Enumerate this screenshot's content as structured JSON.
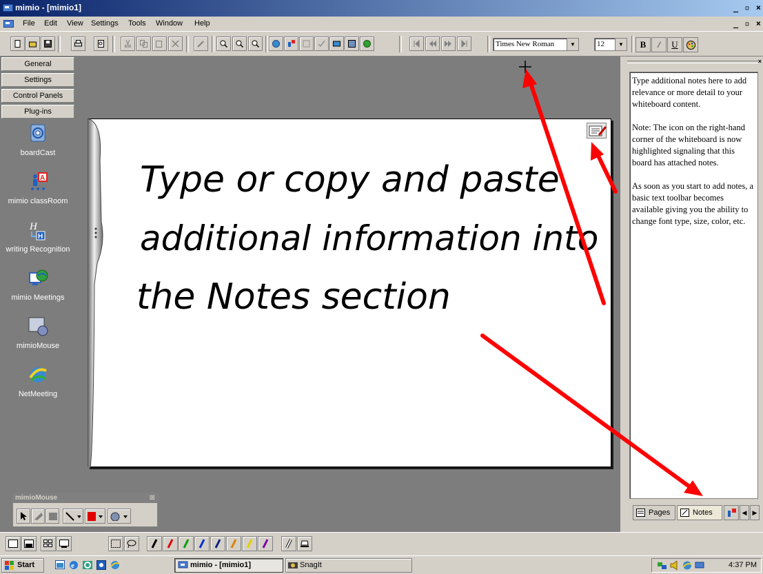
{
  "window": {
    "title": "mimio - [mimio1]",
    "controls": "_ ▫ ×"
  },
  "menu": {
    "items": [
      "File",
      "Edit",
      "View",
      "Settings",
      "Tools",
      "Window",
      "Help"
    ]
  },
  "toolbar": {
    "font_name": "Times New Roman",
    "font_size": "12",
    "bold_label": "B",
    "italic_label": "/",
    "underline_label": "U"
  },
  "sidebar": {
    "headers": [
      "General",
      "Settings",
      "Control Panels",
      "Plug-ins"
    ],
    "plugins": [
      {
        "label": "boardCast",
        "icon": "boardcast-icon"
      },
      {
        "label": "mimio classRoom",
        "icon": "classroom-icon"
      },
      {
        "label": "writing Recognition",
        "icon": "writing-recognition-icon"
      },
      {
        "label": "mimio Meetings",
        "icon": "meetings-icon"
      },
      {
        "label": "mimioMouse",
        "icon": "mimiomouse-icon"
      },
      {
        "label": "NetMeeting",
        "icon": "netmeeting-icon"
      }
    ]
  },
  "board": {
    "handwriting": [
      "Type or copy and paste",
      "additional information into",
      "the Notes section"
    ]
  },
  "notes": {
    "paragraphs": [
      "Type additional notes here to add relevance or more detail to your whiteboard content.",
      "Note: The icon on the right-hand corner of the whiteboard is now highlighted signaling that this board has attached notes.",
      "As soon as you start to add notes, a basic text toolbar becomes available giving you the ability to change font type, size, color, etc."
    ],
    "tabs": [
      "Pages",
      "Notes"
    ]
  },
  "mimiomouse_palette": {
    "title": "mimioMouse"
  },
  "taskbar": {
    "start_label": "Start",
    "tasks": [
      "mimio - [mimio1]",
      "SnagIt"
    ],
    "clock": "4:37 PM"
  },
  "colors": {
    "annotation_arrow": "#ff0000",
    "titlebar_start": "#0a246a",
    "workspace": "#7d7d7d"
  }
}
